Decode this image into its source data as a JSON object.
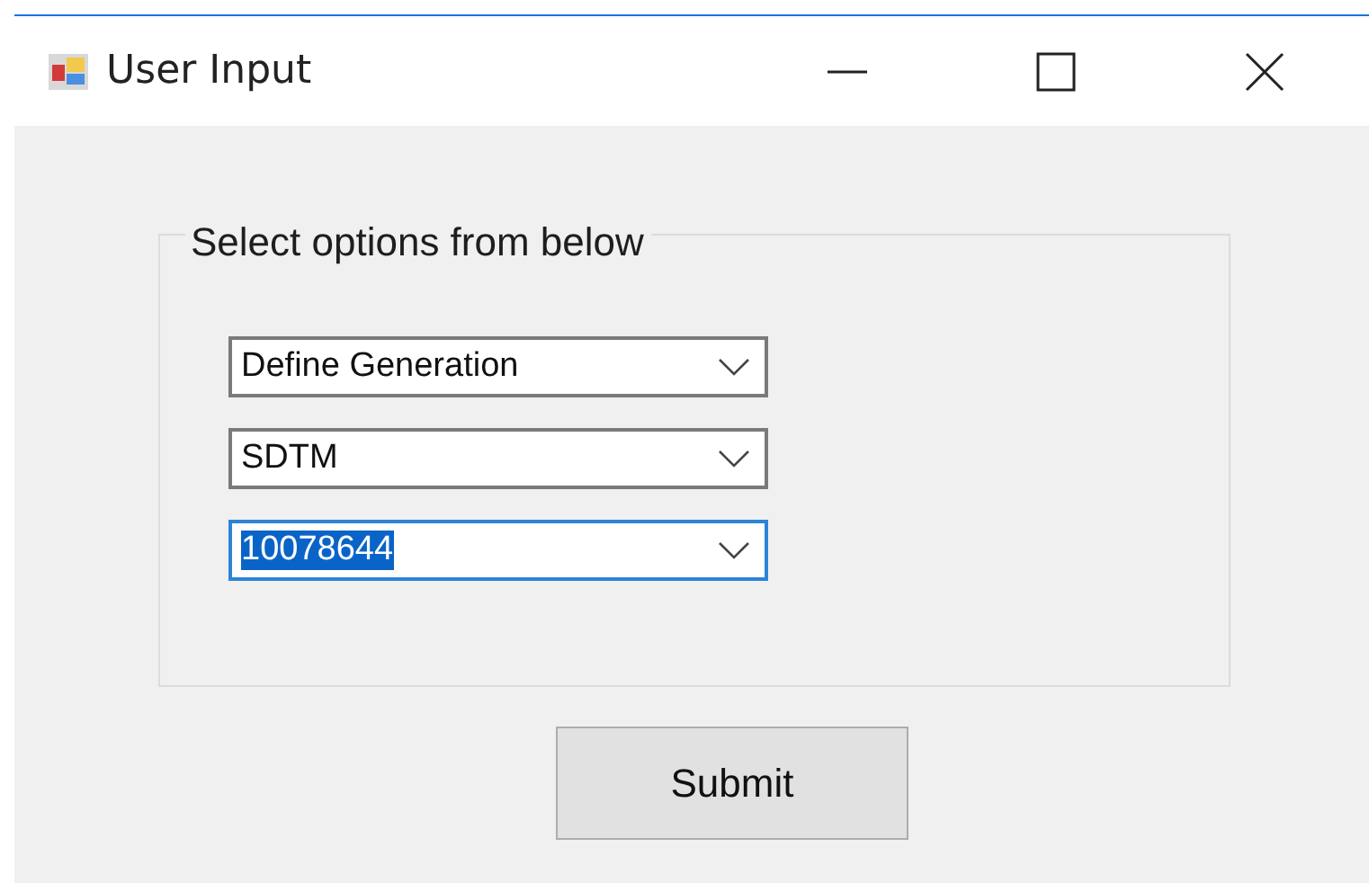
{
  "window": {
    "title": "User Input"
  },
  "group": {
    "title": "Select options from below",
    "dropdowns": [
      {
        "value": "Define Generation",
        "focused": false
      },
      {
        "value": "SDTM",
        "focused": false
      },
      {
        "value": "10078644",
        "focused": true
      }
    ]
  },
  "buttons": [
    "Submit"
  ]
}
